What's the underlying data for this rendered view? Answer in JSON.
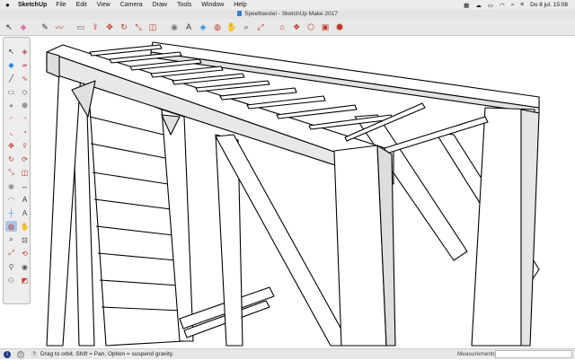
{
  "menubar": {
    "apple": "",
    "app_name": "SketchUp",
    "items": [
      "File",
      "Edit",
      "View",
      "Camera",
      "Draw",
      "Tools",
      "Window",
      "Help"
    ],
    "datetime": "Do 8 jul.  15:08"
  },
  "window": {
    "title": "Speeltoestel - SketchUp Make 2017"
  },
  "toolbar": {
    "tools": [
      {
        "name": "select-arrow-icon",
        "glyph": "↖",
        "color": "#222"
      },
      {
        "name": "eraser-icon",
        "glyph": "◆",
        "color": "#d87aa8"
      },
      {
        "name": "line-pencil-icon",
        "glyph": "✎",
        "color": "#333"
      },
      {
        "name": "freehand-icon",
        "glyph": "〰",
        "color": "#c0392b"
      },
      {
        "name": "rectangle-icon",
        "glyph": "▭",
        "color": "#555"
      },
      {
        "name": "push-pull-icon",
        "glyph": "⇪",
        "color": "#c0392b"
      },
      {
        "name": "move-icon",
        "glyph": "✥",
        "color": "#c0392b"
      },
      {
        "name": "rotate-icon",
        "glyph": "↻",
        "color": "#c0392b"
      },
      {
        "name": "scale-icon",
        "glyph": "⤡",
        "color": "#c0392b"
      },
      {
        "name": "offset-icon",
        "glyph": "◫",
        "color": "#c0392b"
      },
      {
        "name": "tape-measure-icon",
        "glyph": "◉",
        "color": "#777"
      },
      {
        "name": "text-icon",
        "glyph": "A",
        "color": "#333"
      },
      {
        "name": "paint-bucket-icon",
        "glyph": "◈",
        "color": "#2e86de"
      },
      {
        "name": "orbit-icon",
        "glyph": "◍",
        "color": "#c0392b"
      },
      {
        "name": "pan-icon",
        "glyph": "✋",
        "color": "#555"
      },
      {
        "name": "zoom-icon",
        "glyph": "⌕",
        "color": "#333"
      },
      {
        "name": "zoom-extents-icon",
        "glyph": "⤢",
        "color": "#c0392b"
      },
      {
        "name": "warehouse-icon",
        "glyph": "⌂",
        "color": "#c0392b"
      },
      {
        "name": "extension-warehouse-icon",
        "glyph": "❖",
        "color": "#c0392b"
      },
      {
        "name": "share-model-icon",
        "glyph": "⬡",
        "color": "#c0392b"
      },
      {
        "name": "layout-icon",
        "glyph": "▣",
        "color": "#c0392b"
      },
      {
        "name": "extensions-icon",
        "glyph": "⬢",
        "color": "#c0392b"
      }
    ]
  },
  "palette": {
    "tools": [
      {
        "name": "select-icon",
        "glyph": "↖",
        "color": "#222"
      },
      {
        "name": "make-component-icon",
        "glyph": "◈",
        "color": "#b05050"
      },
      {
        "name": "paint-icon",
        "glyph": "◆",
        "color": "#2e86de"
      },
      {
        "name": "eraser-icon",
        "glyph": "▰",
        "color": "#d87aa8"
      },
      {
        "name": "line-icon",
        "glyph": "╱",
        "color": "#333"
      },
      {
        "name": "freehand-icon",
        "glyph": "∿",
        "color": "#c0392b"
      },
      {
        "name": "rectangle-icon",
        "glyph": "▭",
        "color": "#555"
      },
      {
        "name": "rotated-rectangle-icon",
        "glyph": "◇",
        "color": "#555"
      },
      {
        "name": "circle-icon",
        "glyph": "●",
        "color": "#999"
      },
      {
        "name": "polygon-icon",
        "glyph": "⬢",
        "color": "#999"
      },
      {
        "name": "arc-icon",
        "glyph": "◜",
        "color": "#c0392b"
      },
      {
        "name": "two-point-arc-icon",
        "glyph": "◝",
        "color": "#c0392b"
      },
      {
        "name": "three-point-arc-icon",
        "glyph": "◟",
        "color": "#c0392b"
      },
      {
        "name": "pie-icon",
        "glyph": "◔",
        "color": "#c0392b"
      },
      {
        "name": "move-icon",
        "glyph": "✥",
        "color": "#c0392b"
      },
      {
        "name": "push-pull-icon",
        "glyph": "⇪",
        "color": "#c0392b"
      },
      {
        "name": "rotate-icon",
        "glyph": "↻",
        "color": "#c0392b"
      },
      {
        "name": "follow-me-icon",
        "glyph": "⟳",
        "color": "#c0392b"
      },
      {
        "name": "scale-icon",
        "glyph": "⤡",
        "color": "#c0392b"
      },
      {
        "name": "offset-icon",
        "glyph": "◫",
        "color": "#c0392b"
      },
      {
        "name": "tape-measure-icon",
        "glyph": "◉",
        "color": "#888"
      },
      {
        "name": "dimension-icon",
        "glyph": "↔",
        "color": "#333"
      },
      {
        "name": "protractor-icon",
        "glyph": "◠",
        "color": "#777"
      },
      {
        "name": "text-icon",
        "glyph": "A",
        "color": "#333"
      },
      {
        "name": "axes-icon",
        "glyph": "┼",
        "color": "#2e86de"
      },
      {
        "name": "3d-text-icon",
        "glyph": "A",
        "color": "#444"
      },
      {
        "name": "orbit-icon",
        "glyph": "◍",
        "color": "#c0392b",
        "active": true
      },
      {
        "name": "pan-icon",
        "glyph": "✋",
        "color": "#555"
      },
      {
        "name": "zoom-icon",
        "glyph": "⌕",
        "color": "#333"
      },
      {
        "name": "zoom-window-icon",
        "glyph": "⊡",
        "color": "#333"
      },
      {
        "name": "zoom-extents-icon",
        "glyph": "⤢",
        "color": "#c0392b"
      },
      {
        "name": "previous-view-icon",
        "glyph": "⟲",
        "color": "#c0392b"
      },
      {
        "name": "position-camera-icon",
        "glyph": "⚲",
        "color": "#555"
      },
      {
        "name": "look-around-icon",
        "glyph": "◉",
        "color": "#555"
      },
      {
        "name": "walk-icon",
        "glyph": "⚇",
        "color": "#555"
      },
      {
        "name": "section-plane-icon",
        "glyph": "◩",
        "color": "#c0392b"
      }
    ]
  },
  "status": {
    "hint": "Drag to orbit. Shift = Pan, Option = suspend gravity.",
    "measurements_label": "Measurements",
    "measurements_value": ""
  },
  "colors": {
    "model_face": "#ffffff",
    "model_edge": "#000000",
    "model_shade": "#d8d8d8"
  }
}
